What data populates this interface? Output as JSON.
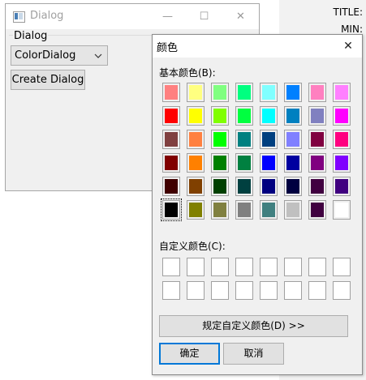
{
  "background": {
    "labels": [
      "TITLE:",
      "MIN:"
    ]
  },
  "main_window": {
    "title": "Dialog",
    "controls": {
      "minimize": "—",
      "maximize": "☐",
      "close": "✕"
    },
    "group_title": "Dialog",
    "combo_value": "ColorDialog",
    "create_button": "Create Dialog"
  },
  "color_dialog": {
    "title": "颜色",
    "close": "✕",
    "basic_label": "基本颜色(B):",
    "custom_label": "自定义颜色(C):",
    "define_custom_button": "规定自定义颜色(D) >>",
    "ok_button": "确定",
    "cancel_button": "取消",
    "selected_index": 40,
    "basic_colors": [
      "#ff8080",
      "#ffff80",
      "#80ff80",
      "#00ff80",
      "#80ffff",
      "#0080ff",
      "#ff80c0",
      "#ff80ff",
      "#ff0000",
      "#ffff00",
      "#80ff00",
      "#00ff40",
      "#00ffff",
      "#0080c0",
      "#8080c0",
      "#ff00ff",
      "#804040",
      "#ff8040",
      "#00ff00",
      "#008080",
      "#004080",
      "#8080ff",
      "#800040",
      "#ff0080",
      "#800000",
      "#ff8000",
      "#008000",
      "#008040",
      "#0000ff",
      "#0000a0",
      "#800080",
      "#8000ff",
      "#400000",
      "#804000",
      "#004000",
      "#004040",
      "#000080",
      "#000040",
      "#400040",
      "#400080",
      "#000000",
      "#808000",
      "#808040",
      "#808080",
      "#408080",
      "#c0c0c0",
      "#400040",
      "#ffffff"
    ],
    "custom_colors": [
      "#ffffff",
      "#ffffff",
      "#ffffff",
      "#ffffff",
      "#ffffff",
      "#ffffff",
      "#ffffff",
      "#ffffff",
      "#ffffff",
      "#ffffff",
      "#ffffff",
      "#ffffff",
      "#ffffff",
      "#ffffff",
      "#ffffff",
      "#ffffff"
    ]
  }
}
